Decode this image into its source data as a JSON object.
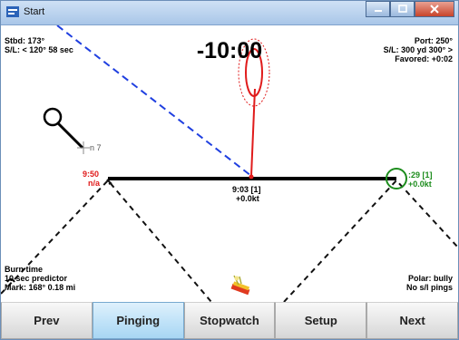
{
  "window": {
    "title": "Start",
    "colors": {
      "titlebar": "#bcd4f0",
      "close": "#c8432a"
    }
  },
  "board": {
    "timer": "-10:00",
    "stbd": "Stbd: 173°",
    "sl_left": "S/L: < 120° 58 sec",
    "port": "Port: 250°",
    "sl_right": "S/L: 300 yd 300° >",
    "favored": "Favored: +0:02",
    "mark_label": "n 7",
    "left_end_time": "9:50",
    "left_end_sub": "n/a",
    "mid_time": "9:03 [1]",
    "mid_speed": "+0.0kt",
    "right_end_time": ":29 [1]",
    "right_end_speed": "+0.0kt",
    "burn_time": "Burn time",
    "predictor": "10 sec predictor",
    "mark_info": "Mark: 168° 0.18 mi",
    "polar": "Polar: bully",
    "pings": "No s/l pings",
    "colors": {
      "red": "#e01b1b",
      "green": "#1c8c1c",
      "blue": "#1f3fe0"
    },
    "icons": {
      "boat": "sailboat-icon"
    }
  },
  "toolbar": {
    "buttons": [
      {
        "label": "Prev",
        "active": false
      },
      {
        "label": "Pinging",
        "active": true
      },
      {
        "label": "Stopwatch",
        "active": false
      },
      {
        "label": "Setup",
        "active": false
      },
      {
        "label": "Next",
        "active": false
      }
    ]
  }
}
